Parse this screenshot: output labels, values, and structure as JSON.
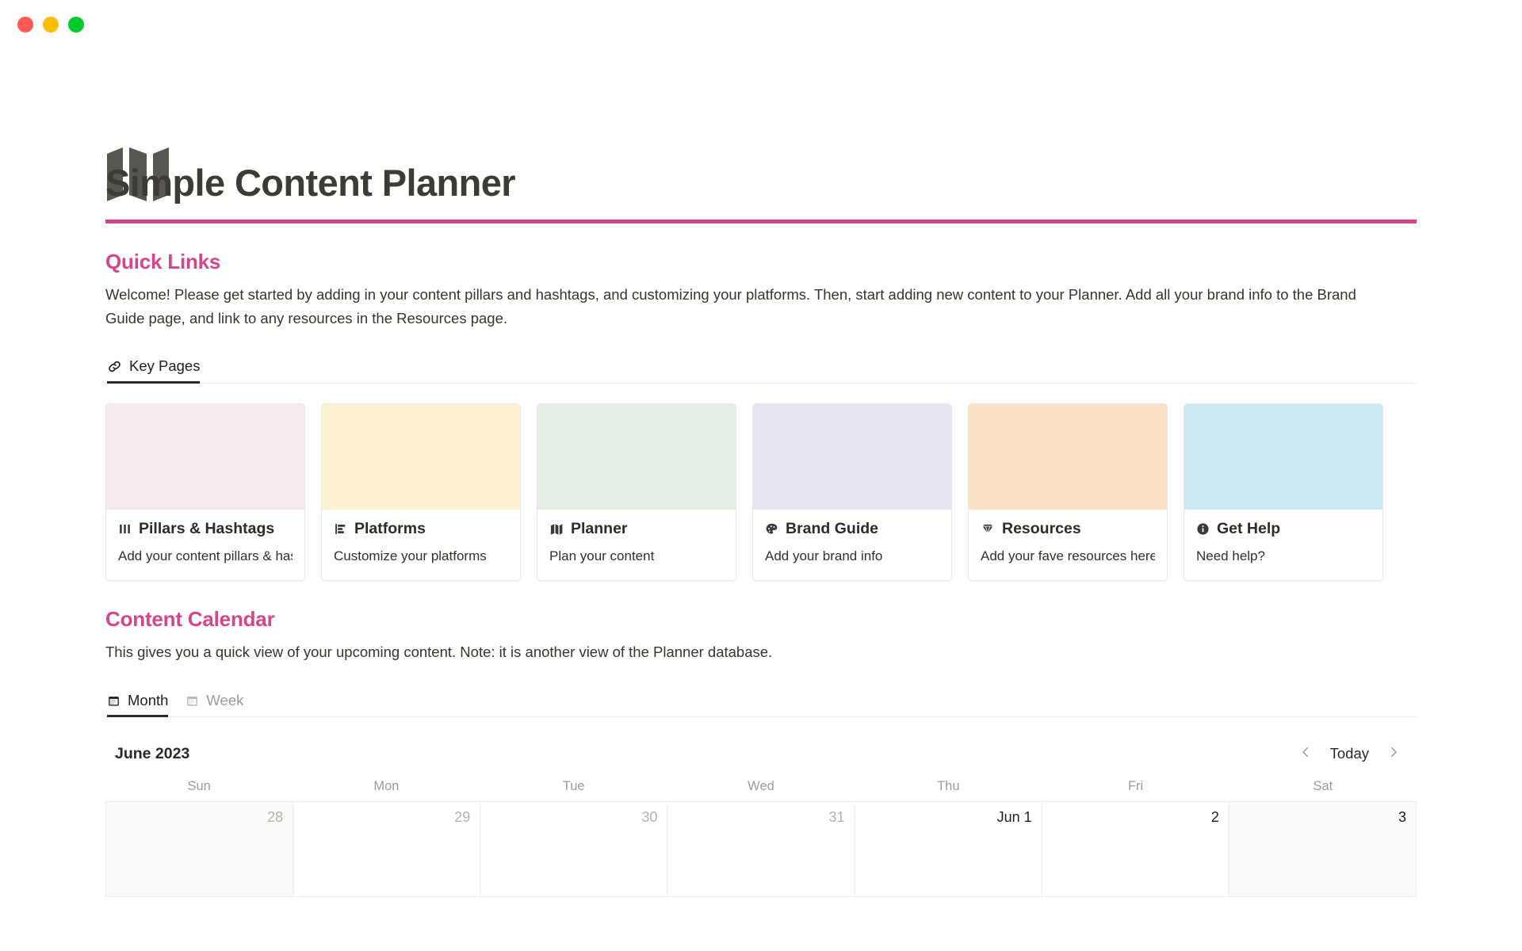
{
  "window": {
    "controls": [
      {
        "name": "close",
        "color": "#ff5a52"
      },
      {
        "name": "minimize",
        "color": "#ffbd06"
      },
      {
        "name": "maximize",
        "color": "#00ca2c"
      }
    ]
  },
  "header": {
    "logo_icon": "folded-map-icon",
    "title": "Simple Content Planner",
    "divider_color": "#d5458a"
  },
  "quick_links": {
    "heading": "Quick Links",
    "description": "Welcome! Please get started by adding in your content pillars and hashtags, and customizing your platforms. Then, start adding new content to your Planner. Add all your brand info to the Brand Guide page, and link to any resources in the Resources page.",
    "tabs": [
      {
        "label": "Key Pages",
        "icon": "link-icon",
        "active": true
      }
    ],
    "cards": [
      {
        "title": "Pillars & Hashtags",
        "subtitle": "Add your content pillars & hashtags",
        "icon": "bars-icon",
        "cover_color": "#f8e8ef"
      },
      {
        "title": "Platforms",
        "subtitle": "Customize your platforms",
        "icon": "bar-chart-icon",
        "cover_color": "#fbf0d1"
      },
      {
        "title": "Planner",
        "subtitle": "Plan your content",
        "icon": "map-icon",
        "cover_color": "#e4ede4"
      },
      {
        "title": "Brand Guide",
        "subtitle": "Add your brand info",
        "icon": "palette-icon",
        "cover_color": "#e9e4f1"
      },
      {
        "title": "Resources",
        "subtitle": "Add your fave resources here",
        "icon": "gem-icon",
        "cover_color": "#fbe0c8"
      },
      {
        "title": "Get Help",
        "subtitle": "Need help?",
        "icon": "info-icon",
        "cover_color": "#cfe9f2"
      }
    ]
  },
  "content_calendar": {
    "heading": "Content Calendar",
    "description": "This gives you a quick view of your upcoming content. Note: it is another view of the Planner database.",
    "tabs": [
      {
        "label": "Month",
        "icon": "calendar-icon",
        "active": true
      },
      {
        "label": "Week",
        "icon": "calendar-icon",
        "active": false
      }
    ],
    "month_label": "June 2023",
    "nav": {
      "prev_icon": "chevron-left-icon",
      "today_label": "Today",
      "next_icon": "chevron-right-icon"
    },
    "weekdays": [
      "Sun",
      "Mon",
      "Tue",
      "Wed",
      "Thu",
      "Fri",
      "Sat"
    ],
    "days": [
      {
        "label": "28",
        "muted": true,
        "weekend": true
      },
      {
        "label": "29",
        "muted": true,
        "weekend": false
      },
      {
        "label": "30",
        "muted": true,
        "weekend": false
      },
      {
        "label": "31",
        "muted": true,
        "weekend": false
      },
      {
        "label": "Jun 1",
        "muted": false,
        "weekend": false
      },
      {
        "label": "2",
        "muted": false,
        "weekend": false
      },
      {
        "label": "3",
        "muted": false,
        "weekend": true
      }
    ]
  }
}
